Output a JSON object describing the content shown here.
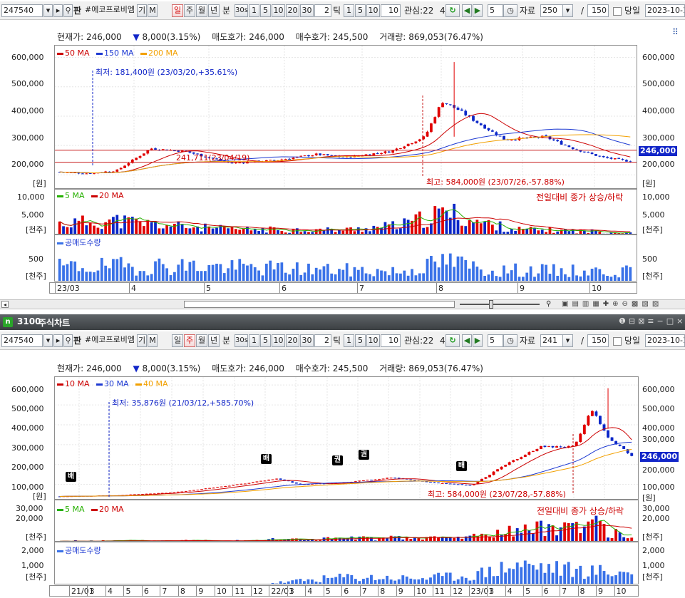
{
  "toolbar": {
    "code": "247540",
    "name": "#에코프로비엠",
    "btn_gi": "기",
    "btn_m": "M",
    "btn_pan": "판",
    "periods": [
      "일",
      "주",
      "월",
      "년",
      "분"
    ],
    "sec_label": "30s",
    "intervals": [
      "1",
      "5",
      "10",
      "20",
      "30"
    ],
    "tick_value": "2",
    "tick_label": "틱",
    "tick_intervals": [
      "1",
      "5",
      "10"
    ],
    "tick_input": "10",
    "interest_label": "관심:22",
    "interest_count": "4",
    "step_value": "5",
    "data_label": "자료",
    "sep": "/",
    "today_label": "당일",
    "date": "2023-10-1"
  },
  "top_toolbar": {
    "data_count": "250",
    "total": "150"
  },
  "bottom_toolbar": {
    "data_count": "241",
    "total": "150"
  },
  "window_title": {
    "number": "3100",
    "title": "주식차트"
  },
  "info": {
    "current_label": "현재가:",
    "current_value": "246,000",
    "change_arrow": "▼",
    "change_value": "8,000(3.15%)",
    "ask_label": "매도호가:",
    "ask_value": "246,000",
    "bid_label": "매수호가:",
    "bid_value": "245,500",
    "volume_label": "거래량:",
    "volume_value": "869,053(76.47%)"
  },
  "colors": {
    "up": "#e00000",
    "down": "#0a26c8",
    "ma_red": "#cc0000",
    "ma_blue": "#1e3ad2",
    "ma_orange": "#f2a000",
    "vol_green": "#26b000",
    "short": "#3a72e8",
    "tag": "#1226c8"
  },
  "top_chart": {
    "legend": [
      "50 MA",
      "150 MA",
      "200 MA"
    ],
    "y_labels": [
      "600,000",
      "500,000",
      "400,000",
      "300,000",
      "200,000"
    ],
    "y_unit": "[원]",
    "price_tag": "246,000",
    "low_note": "최저: 181,400원 (23/03/20,+35.61%)",
    "high_note": "최고: 584,000원 (23/07/26,-57.88%)",
    "mid_note": "241,711(23/04/19)",
    "vol_legend": [
      "5 MA",
      "20 MA"
    ],
    "vol_note": "전일대비 종가 상승/하락",
    "vol_y_labels": [
      "10,000",
      "5,000"
    ],
    "vol_unit": "[천주]",
    "short_legend": "공매도수량",
    "short_y_labels": [
      "500"
    ],
    "short_unit": "[천주]",
    "x_labels": [
      "23/03",
      "4",
      "5",
      "6",
      "7",
      "8",
      "9",
      "10"
    ]
  },
  "bottom_chart": {
    "legend": [
      "10 MA",
      "30 MA",
      "40 MA"
    ],
    "y_labels": [
      "600,000",
      "500,000",
      "400,000",
      "300,000",
      "200,000",
      "100,000"
    ],
    "y_unit": "[원]",
    "price_tag": "246,000",
    "low_note": "최저: 35,876원 (21/03/12,+585.70%)",
    "high_note": "최고: 584,000원 (23/07/28,-57.88%)",
    "markers": [
      "배",
      "배",
      "권",
      "권",
      "배"
    ],
    "vol_legend": [
      "5 MA",
      "20 MA"
    ],
    "vol_note": "전일대비 종가 상승/하락",
    "vol_y_labels": [
      "30,000",
      "20,000"
    ],
    "vol_unit": "[천주]",
    "short_legend": "공매도수량",
    "short_y_labels": [
      "2,000",
      "1,000"
    ],
    "short_unit": "[천주]",
    "x_labels": [
      "21/01",
      "3",
      "4",
      "5",
      "6",
      "7",
      "8",
      "9",
      "10",
      "11",
      "12",
      "22/01",
      "3",
      "4",
      "5",
      "6",
      "7",
      "8",
      "9",
      "10",
      "11",
      "12",
      "23/01",
      "3",
      "4",
      "5",
      "6",
      "7",
      "8",
      "9",
      "10"
    ]
  },
  "chart_data": [
    {
      "type": "candlestick",
      "title": "",
      "period": "daily",
      "ylim": [
        150000,
        640000
      ],
      "series": [
        {
          "name": "price",
          "approx_x": [
            "23/03",
            "4",
            "5",
            "6",
            "7",
            "8",
            "9",
            "10"
          ],
          "approx_close": [
            200000,
            300000,
            240000,
            270000,
            290000,
            440000,
            310000,
            246000
          ]
        },
        {
          "name": "50 MA"
        },
        {
          "name": "150 MA"
        },
        {
          "name": "200 MA"
        }
      ],
      "current": 246000,
      "high": 584000,
      "low": 181400
    },
    {
      "type": "candlestick",
      "title": "",
      "period": "weekly",
      "ylim": [
        20000,
        640000
      ],
      "series": [
        {
          "name": "price",
          "approx_x": [
            "21/01",
            "7",
            "22/01",
            "7",
            "23/01",
            "7",
            "10"
          ],
          "approx_close": [
            40000,
            90000,
            130000,
            130000,
            110000,
            500000,
            246000
          ]
        },
        {
          "name": "10 MA"
        },
        {
          "name": "30 MA"
        },
        {
          "name": "40 MA"
        }
      ],
      "current": 246000,
      "high": 584000,
      "low": 35876
    }
  ]
}
